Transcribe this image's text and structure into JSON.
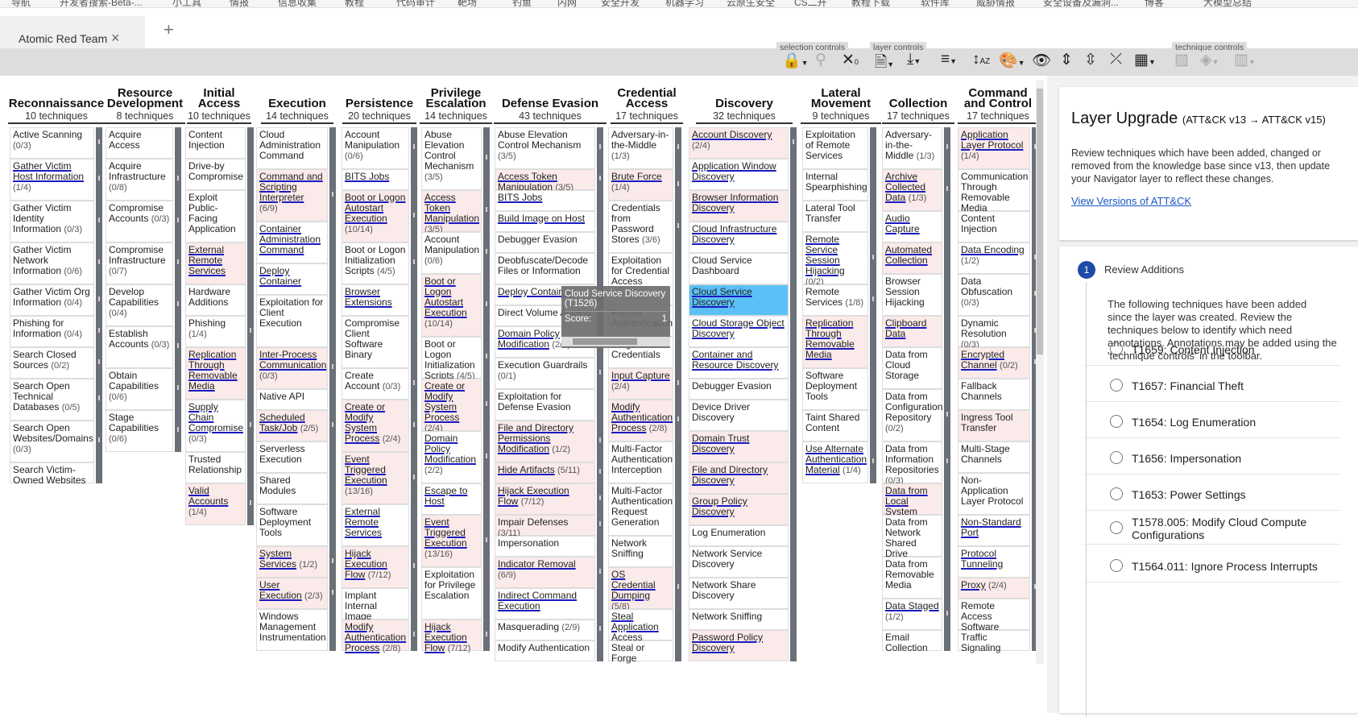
{
  "browser": {
    "bookmarks": [
      "导航",
      "开发者搜索-Beta-...",
      "小工具",
      "情报",
      "信息收集",
      "教程",
      "代码审计",
      "靶场",
      "钓鱼",
      "内网",
      "安全开发",
      "机器学习",
      "云原生安全",
      "CS二开",
      "教程下载",
      "软件库",
      "威胁情报",
      "安全设备及漏洞...",
      "博客",
      "大模型总结"
    ],
    "tab_title": "Atomic Red Team",
    "tab_close": "×",
    "tab_add": "+"
  },
  "toolbar": {
    "selection_controls_label": "selection controls",
    "layer_controls_label": "layer controls",
    "technique_controls_label": "technique controls",
    "icons": [
      "lock-icon",
      "search-icon",
      "deselect-icon",
      "layer-info-icon",
      "download-icon",
      "filter-icon",
      "sort-icon",
      "color-setup-icon",
      "eye-icon",
      "expand-icon",
      "collapse-all-icon",
      "collapse-icon",
      "layout-icon",
      "disable-icon",
      "fill-color-icon",
      "scoring-icon"
    ]
  },
  "matrix": {
    "tactics": [
      {
        "name": "Reconnaissance",
        "count": "10  techniques"
      },
      {
        "name": "Resource Development",
        "count": "8  techniques"
      },
      {
        "name": "Initial Access",
        "count": "10  techniques"
      },
      {
        "name": "Execution",
        "count": "14  techniques"
      },
      {
        "name": "Persistence",
        "count": "20  techniques"
      },
      {
        "name": "Privilege Escalation",
        "count": "14  techniques"
      },
      {
        "name": "Defense Evasion",
        "count": "43  techniques"
      },
      {
        "name": "Credential Access",
        "count": "17  techniques"
      },
      {
        "name": "Discovery",
        "count": "32  techniques"
      },
      {
        "name": "Lateral Movement",
        "count": "9  techniques"
      },
      {
        "name": "Collection",
        "count": "17  techniques"
      },
      {
        "name": "Command and Control",
        "count": "17  techniques"
      }
    ],
    "columns": [
      [
        {
          "name": "Active Scanning",
          "count": "(0/3)"
        },
        {
          "name": "Gather Victim Host Information",
          "count": "(1/4)",
          "u": true
        },
        {
          "name": "Gather Victim Identity Information",
          "count": "(0/3)"
        },
        {
          "name": "Gather Victim Network Information",
          "count": "(0/6)"
        },
        {
          "name": "Gather Victim Org Information",
          "count": "(0/4)"
        },
        {
          "name": "Phishing for Information",
          "count": "(0/4)"
        },
        {
          "name": "Search Closed Sources",
          "count": "(0/2)"
        },
        {
          "name": "Search Open Technical Databases",
          "count": "(0/5)"
        },
        {
          "name": "Search Open Websites/Domains",
          "count": "(0/3)"
        },
        {
          "name": "Search Victim-Owned Websites",
          "count": ""
        }
      ],
      [
        {
          "name": "Acquire Access",
          "count": ""
        },
        {
          "name": "Acquire Infrastructure",
          "count": "(0/8)"
        },
        {
          "name": "Compromise Accounts",
          "count": "(0/3)"
        },
        {
          "name": "Compromise Infrastructure",
          "count": "(0/7)"
        },
        {
          "name": "Develop Capabilities",
          "count": "(0/4)"
        },
        {
          "name": "Establish Accounts",
          "count": "(0/3)"
        },
        {
          "name": "Obtain Capabilities",
          "count": "(0/6)"
        },
        {
          "name": "Stage Capabilities",
          "count": "(0/6)"
        }
      ],
      [
        {
          "name": "Content Injection",
          "count": ""
        },
        {
          "name": "Drive-by Compromise",
          "count": ""
        },
        {
          "name": "Exploit Public-Facing Application",
          "count": ""
        },
        {
          "name": "External Remote Services",
          "count": "",
          "u": true,
          "sel": true
        },
        {
          "name": "Hardware Additions",
          "count": ""
        },
        {
          "name": "Phishing",
          "count": "(1/4)"
        },
        {
          "name": "Replication Through Removable Media",
          "count": "",
          "u": true,
          "sel": true
        },
        {
          "name": "Supply Chain Compromise",
          "count": "(0/3)",
          "u": true
        },
        {
          "name": "Trusted Relationship",
          "count": ""
        },
        {
          "name": "Valid Accounts",
          "count": "(1/4)",
          "u": true,
          "sel": true
        }
      ],
      [
        {
          "name": "Cloud Administration Command",
          "count": ""
        },
        {
          "name": "Command and Scripting Interpreter",
          "count": "(6/9)",
          "u": true,
          "sel": true
        },
        {
          "name": "Container Administration Command",
          "count": "",
          "u": true
        },
        {
          "name": "Deploy Container",
          "count": "",
          "u": true
        },
        {
          "name": "Exploitation for Client Execution",
          "count": ""
        },
        {
          "name": "Inter-Process Communication",
          "count": "(0/3)",
          "u": true,
          "sel": true
        },
        {
          "name": "Native API",
          "count": ""
        },
        {
          "name": "Scheduled Task/Job",
          "count": "(2/5)",
          "u": true,
          "sel": true
        },
        {
          "name": "Serverless Execution",
          "count": ""
        },
        {
          "name": "Shared Modules",
          "count": ""
        },
        {
          "name": "Software Deployment Tools",
          "count": ""
        },
        {
          "name": "System Services",
          "count": "(1/2)",
          "u": true,
          "sel": true
        },
        {
          "name": "User Execution",
          "count": "(2/3)",
          "u": true,
          "sel": true
        },
        {
          "name": "Windows Management Instrumentation",
          "count": ""
        }
      ],
      [
        {
          "name": "Account Manipulation",
          "count": "(0/6)"
        },
        {
          "name": "BITS Jobs",
          "count": "",
          "u": true
        },
        {
          "name": "Boot or Logon Autostart Execution",
          "count": "(10/14)",
          "u": true,
          "sel": true
        },
        {
          "name": "Boot or Logon Initialization Scripts",
          "count": "(4/5)"
        },
        {
          "name": "Browser Extensions",
          "count": "",
          "u": true
        },
        {
          "name": "Compromise Client Software Binary",
          "count": ""
        },
        {
          "name": "Create Account",
          "count": "(0/3)"
        },
        {
          "name": "Create or Modify System Process",
          "count": "(2/4)",
          "u": true,
          "sel": true
        },
        {
          "name": "Event Triggered Execution",
          "count": "(13/16)",
          "u": true,
          "sel": true
        },
        {
          "name": "External Remote Services",
          "count": "",
          "u": true
        },
        {
          "name": "Hijack Execution Flow",
          "count": "(7/12)",
          "u": true,
          "sel": true
        },
        {
          "name": "Implant Internal Image",
          "count": ""
        },
        {
          "name": "Modify Authentication Process",
          "count": "(2/8)",
          "u": true,
          "sel": true
        }
      ],
      [
        {
          "name": "Abuse Elevation Control Mechanism",
          "count": "(3/5)"
        },
        {
          "name": "Access Token Manipulation",
          "count": "(3/5)",
          "u": true,
          "sel": true
        },
        {
          "name": "Account Manipulation",
          "count": "(0/6)"
        },
        {
          "name": "Boot or Logon Autostart Execution",
          "count": "(10/14)",
          "u": true,
          "sel": true
        },
        {
          "name": "Boot or Logon Initialization Scripts",
          "count": "(4/5)"
        },
        {
          "name": "Create or Modify System Process",
          "count": "(2/4)",
          "u": true,
          "sel": true
        },
        {
          "name": "Domain Policy Modification",
          "count": "(2/2)",
          "u": true
        },
        {
          "name": "Escape to Host",
          "count": "",
          "u": true
        },
        {
          "name": "Event Triggered Execution",
          "count": "(13/16)",
          "u": true,
          "sel": true
        },
        {
          "name": "Exploitation for Privilege Escalation",
          "count": ""
        },
        {
          "name": "Hijack Execution Flow",
          "count": "(7/12)",
          "u": true,
          "sel": true
        }
      ],
      [
        {
          "name": "Abuse Elevation Control Mechanism",
          "count": "(3/5)"
        },
        {
          "name": "Access Token Manipulation",
          "count": "(3/5)",
          "u": true,
          "sel": true
        },
        {
          "name": "BITS Jobs",
          "count": "",
          "u": true
        },
        {
          "name": "Build Image on Host",
          "count": "",
          "u": true
        },
        {
          "name": "Debugger Evasion",
          "count": ""
        },
        {
          "name": "Deobfuscate/Decode Files or Information",
          "count": ""
        },
        {
          "name": "Deploy Container",
          "count": "",
          "u": true
        },
        {
          "name": "Direct Volume Access",
          "count": ""
        },
        {
          "name": "Domain Policy Modification",
          "count": "(2/2)",
          "u": true
        },
        {
          "name": "Execution Guardrails",
          "count": "(0/1)"
        },
        {
          "name": "Exploitation for Defense Evasion",
          "count": ""
        },
        {
          "name": "File and Directory Permissions Modification",
          "count": "(1/2)",
          "u": true,
          "sel": true
        },
        {
          "name": "Hide Artifacts",
          "count": "(5/11)",
          "u": true,
          "sel": true
        },
        {
          "name": "Hijack Execution Flow",
          "count": "(7/12)",
          "u": true,
          "sel": true
        },
        {
          "name": "Impair Defenses",
          "count": "(3/11)",
          "sel": true
        },
        {
          "name": "Impersonation",
          "count": ""
        },
        {
          "name": "Indicator Removal",
          "count": "(6/9)",
          "u": true,
          "sel": true
        },
        {
          "name": "Indirect Command Execution",
          "count": "",
          "u": true
        },
        {
          "name": "Masquerading",
          "count": "(2/9)"
        },
        {
          "name": "Modify Authentication",
          "count": ""
        }
      ],
      [
        {
          "name": "Adversary-in-the-Middle",
          "count": "(1/3)"
        },
        {
          "name": "Brute Force",
          "count": "(1/4)",
          "u": true,
          "sel": true
        },
        {
          "name": "Credentials from Password Stores",
          "count": "(3/6)"
        },
        {
          "name": "Exploitation for Credential Access",
          "count": ""
        },
        {
          "name": "Forced Authentication",
          "count": ""
        },
        {
          "name": "Forge Web Credentials",
          "count": ""
        },
        {
          "name": "Input Capture",
          "count": "(2/4)",
          "u": true,
          "sel": true
        },
        {
          "name": "Modify Authentication Process",
          "count": "(2/8)",
          "u": true,
          "sel": true
        },
        {
          "name": "Multi-Factor Authentication Interception",
          "count": ""
        },
        {
          "name": "Multi-Factor Authentication Request Generation",
          "count": ""
        },
        {
          "name": "Network Sniffing",
          "count": ""
        },
        {
          "name": "OS Credential Dumping",
          "count": "(5/8)",
          "u": true,
          "sel": true
        },
        {
          "name": "Steal Application Access Token",
          "count": "",
          "u": true
        },
        {
          "name": "Steal or Forge",
          "count": ""
        }
      ],
      [
        {
          "name": "Account Discovery",
          "count": "(2/4)",
          "u": true,
          "sel": true
        },
        {
          "name": "Application Window Discovery",
          "count": "",
          "u": true
        },
        {
          "name": "Browser Information Discovery",
          "count": "",
          "u": true,
          "sel": true
        },
        {
          "name": "Cloud Infrastructure Discovery",
          "count": "",
          "u": true
        },
        {
          "name": "Cloud Service Dashboard",
          "count": ""
        },
        {
          "name": "Cloud Service Discovery",
          "count": "",
          "u": true,
          "hl": true
        },
        {
          "name": "Cloud Storage Object Discovery",
          "count": "",
          "u": true
        },
        {
          "name": "Container and Resource Discovery",
          "count": "",
          "u": true
        },
        {
          "name": "Debugger Evasion",
          "count": ""
        },
        {
          "name": "Device Driver Discovery",
          "count": ""
        },
        {
          "name": "Domain Trust Discovery",
          "count": "",
          "u": true,
          "sel": true
        },
        {
          "name": "File and Directory Discovery",
          "count": "",
          "u": true,
          "sel": true
        },
        {
          "name": "Group Policy Discovery",
          "count": "",
          "u": true,
          "sel": true
        },
        {
          "name": "Log Enumeration",
          "count": ""
        },
        {
          "name": "Network Service Discovery",
          "count": ""
        },
        {
          "name": "Network Share Discovery",
          "count": ""
        },
        {
          "name": "Network Sniffing",
          "count": ""
        },
        {
          "name": "Password Policy Discovery",
          "count": "",
          "u": true,
          "sel": true
        }
      ],
      [
        {
          "name": "Exploitation of Remote Services",
          "count": ""
        },
        {
          "name": "Internal Spearphishing",
          "count": ""
        },
        {
          "name": "Lateral Tool Transfer",
          "count": ""
        },
        {
          "name": "Remote Service Session Hijacking",
          "count": "(0/2)",
          "u": true
        },
        {
          "name": "Remote Services",
          "count": "(1/8)"
        },
        {
          "name": "Replication Through Removable Media",
          "count": "",
          "u": true,
          "sel": true
        },
        {
          "name": "Software Deployment Tools",
          "count": ""
        },
        {
          "name": "Taint Shared Content",
          "count": ""
        },
        {
          "name": "Use Alternate Authentication Material",
          "count": "(1/4)",
          "u": true
        }
      ],
      [
        {
          "name": "Adversary-in-the-Middle",
          "count": "(1/3)"
        },
        {
          "name": "Archive Collected Data",
          "count": "(1/3)",
          "u": true,
          "sel": true
        },
        {
          "name": "Audio Capture",
          "count": "",
          "u": true
        },
        {
          "name": "Automated Collection",
          "count": "",
          "u": true,
          "sel": true
        },
        {
          "name": "Browser Session Hijacking",
          "count": ""
        },
        {
          "name": "Clipboard Data",
          "count": "",
          "u": true,
          "sel": true
        },
        {
          "name": "Data from Cloud Storage",
          "count": ""
        },
        {
          "name": "Data from Configuration Repository",
          "count": "(0/2)"
        },
        {
          "name": "Data from Information Repositories",
          "count": "(0/3)"
        },
        {
          "name": "Data from Local System",
          "count": "",
          "u": true,
          "sel": true
        },
        {
          "name": "Data from Network Shared Drive",
          "count": ""
        },
        {
          "name": "Data from Removable Media",
          "count": ""
        },
        {
          "name": "Data Staged",
          "count": "(1/2)",
          "u": true
        },
        {
          "name": "Email Collection",
          "count": ""
        }
      ],
      [
        {
          "name": "Application Layer Protocol",
          "count": "(1/4)",
          "u": true,
          "sel": true
        },
        {
          "name": "Communication Through Removable Media",
          "count": ""
        },
        {
          "name": "Content Injection",
          "count": ""
        },
        {
          "name": "Data Encoding",
          "count": "(1/2)",
          "u": true
        },
        {
          "name": "Data Obfuscation",
          "count": "(0/3)"
        },
        {
          "name": "Dynamic Resolution",
          "count": "(0/3)"
        },
        {
          "name": "Encrypted Channel",
          "count": "(0/2)",
          "u": true,
          "sel": true
        },
        {
          "name": "Fallback Channels",
          "count": ""
        },
        {
          "name": "Ingress Tool Transfer",
          "count": "",
          "sel": true
        },
        {
          "name": "Multi-Stage Channels",
          "count": ""
        },
        {
          "name": "Non-Application Layer Protocol",
          "count": ""
        },
        {
          "name": "Non-Standard Port",
          "count": "",
          "u": true
        },
        {
          "name": "Protocol Tunneling",
          "count": "",
          "u": true
        },
        {
          "name": "Proxy",
          "count": "(2/4)",
          "u": true,
          "sel": true
        },
        {
          "name": "Remote Access Software",
          "count": ""
        },
        {
          "name": "Traffic Signaling",
          "count": ""
        }
      ]
    ]
  },
  "tooltip": {
    "title": "Cloud Service Discovery (T1526)",
    "score_label": "Score:",
    "score_value": "1"
  },
  "panel": {
    "title": "Layer Upgrade",
    "version": "(ATT&CK v13 → ATT&CK v15)",
    "description": "Review techniques which have been added, changed or\nremoved from the knowledge base since v13, then update\nyour Navigator layer to reflect these changes.",
    "link": "View Versions of ATT&CK",
    "step_number": "1",
    "step_label": "Review Additions",
    "step_description": "The following techniques have been added\nsince the layer was created. Review the\ntechniques below to identify which need\nannotations. Annotations may be added using the\n'technique controls' in the toolbar.",
    "additions": [
      "T1659: Content Injection",
      "T1657: Financial Theft",
      "T1654: Log Enumeration",
      "T1656: Impersonation",
      "T1653: Power Settings",
      "T1578.005: Modify Cloud Compute\nConfigurations",
      "T1564.011: Ignore Process Interrupts"
    ]
  }
}
